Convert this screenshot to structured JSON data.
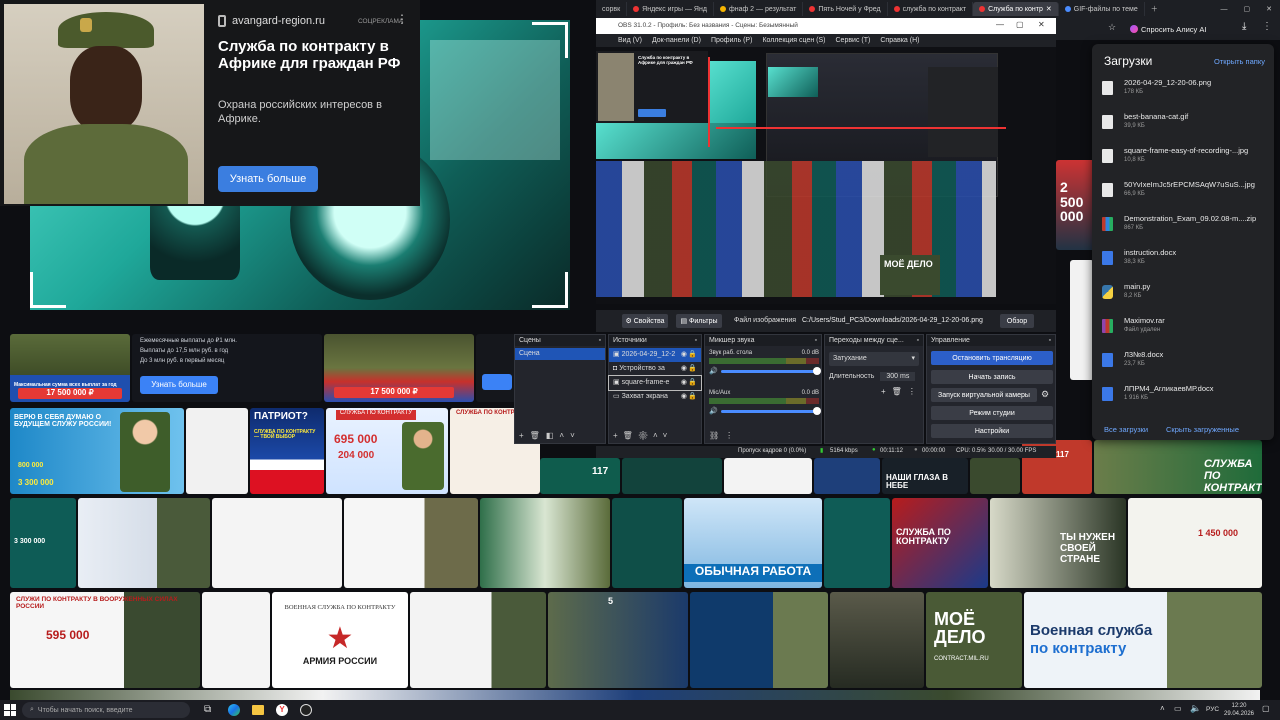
{
  "ad": {
    "domain": "avangard-region.ru",
    "tag": "СОЦРЕКЛАМА",
    "title": "Служба по контракту в Африке для граждан РФ",
    "subtitle": "Охрана российских интересов в Африке.",
    "cta": "Узнать больше"
  },
  "browser": {
    "tabs": [
      {
        "label": "сорвк",
        "color": "#888"
      },
      {
        "label": "Яндекс игры — Янд",
        "color": "#e33"
      },
      {
        "label": "фнаф 2 — результат",
        "color": "#f5b400"
      },
      {
        "label": "Пять Ночей у Фред",
        "color": "#e33"
      },
      {
        "label": "служба по контракт",
        "color": "#e33"
      },
      {
        "label": "Служба по контр",
        "color": "#e33"
      },
      {
        "label": "GIF-файлы по теме",
        "color": "#4a8cff"
      }
    ],
    "alice": "Спросить Алису AI"
  },
  "obs": {
    "title": "OBS 31.0.2 - Профиль: Без названия - Сцены: Безымянный",
    "menu": [
      "Вид (V)",
      "Док-панели (D)",
      "Профиль (P)",
      "Коллекция сцен (S)",
      "Сервис (T)",
      "Справка (H)"
    ],
    "props_label": "Свойства",
    "filters_label": "Фильтры",
    "file_label": "Файл изображения",
    "file_path": "C:/Users/Stud_PC3/Downloads/2026-04-29_12-20-06.png",
    "browse": "Обзор",
    "scenes_title": "Сцены",
    "scenes": [
      "Сцена"
    ],
    "sources_title": "Источники",
    "sources": [
      "2026-04-29_12-2",
      "Устройство за",
      "square-frame-e",
      "Захват экрана"
    ],
    "mixer_title": "Микшер звука",
    "mixer": [
      {
        "name": "Звук раб. стола",
        "db": "0.0 dB"
      },
      {
        "name": "Mic/Aux",
        "db": "0.0 dB"
      }
    ],
    "transitions_title": "Переходы между сце...",
    "transition": "Затухание",
    "duration_label": "Длительность",
    "duration": "300 ms",
    "controls_title": "Управление",
    "controls": [
      "Остановить трансляцию",
      "Начать запись",
      "Запуск виртуальной камеры",
      "Режим студии",
      "Настройки"
    ],
    "status": {
      "dropped": "Пропуск кадров 0 (0.0%)",
      "kbps": "5164 kbps",
      "live": "00:11:12",
      "rec": "00:00:00",
      "cpu": "CPU: 0.5%",
      "fps": "30.00 / 30.00 FPS"
    }
  },
  "downloads": {
    "title": "Загрузки",
    "open_folder": "Открыть папку",
    "items": [
      {
        "name": "2026-04-29_12-20-06.png",
        "size": "178 КБ",
        "color": "#9aa7ff"
      },
      {
        "name": "best-banana-cat.gif",
        "size": "39,9 КБ",
        "color": "#9aa7ff"
      },
      {
        "name": "square-frame-easy-of-recording-...jpg",
        "size": "10,8 КБ",
        "color": "#9aa7ff"
      },
      {
        "name": "50YvIxeImJc5rEPCMSAqW7uSuS...jpg",
        "size": "66,9 КБ",
        "color": "#9aa7ff"
      },
      {
        "name": "Demonstration_Exam_09.02.08-m....zip",
        "size": "867 КБ",
        "color": "#e6a23c"
      },
      {
        "name": "instruction.docx",
        "size": "38,3 КБ",
        "color": "#3b78e7"
      },
      {
        "name": "main.py",
        "size": "8,2 КБ",
        "color": "#f5d142"
      },
      {
        "name": "Maximov.rar",
        "size": "Файл удален",
        "color": "#b04fa0"
      },
      {
        "name": "Л3№8.docx",
        "size": "23,7 КБ",
        "color": "#3b78e7"
      },
      {
        "name": "ЛПРМ4_АгликаевМР.docx",
        "size": "1 916 КБ",
        "color": "#3b78e7"
      }
    ],
    "all": "Все загрузки",
    "hide": "Скрыть загруженные"
  },
  "grid": {
    "tile1_cta": "Узнать больше",
    "tile1_text": [
      "Ежемесячные выплаты до ₽1 млн.",
      "Выплаты до 17,5 млн руб. в год",
      "До 3 млн руб. в первый месяц"
    ],
    "tile1_sum": "Максимальная сумма всех выплат за год",
    "tile1_amount": "17 500 000 ₽",
    "tile2_amount": "17 500 000 ₽",
    "t_verim": "ВЕРЮ В СЕБЯ ДУМАЮ О БУДУЩЕМ СЛУЖУ РОССИИ!",
    "t_verim_nums": [
      "800 000",
      "3 300 000"
    ],
    "t_patriot": "ПАТРИОТ?",
    "t_patriot_sub": "СЛУЖБА ПО КОНТРАКТУ — ТВОЙ ВЫБОР",
    "t_695": "695 000",
    "t_204": "204 000",
    "t_sluzhba": "СЛУЖБА ПО КОНТРАКТУ",
    "t_117": "117",
    "t_nashi": "НАШИ ГЛАЗА В НЕБЕ",
    "t_obych": "ОБЫЧНАЯ РАБОТА",
    "t_nuzhen": "ТЫ НУЖЕН СВОЕЙ СТРАНЕ",
    "t_vvs": "СЛУЖИ ПО КОНТРАКТУ В ВООРУЖЕННЫХ СИЛАХ РОССИИ",
    "t_595": "595 000",
    "t_army": "АРМИЯ РОССИИ",
    "t_voen": "ВОЕННАЯ СЛУЖБА ПО КОНТРАКТУ",
    "t_moe": "МОЁ ДЕЛО",
    "t_moe_site": "CONTRACT.MIL.RU",
    "t_voen2": "Военная служба",
    "t_voen2b": "по контракту",
    "t_3300": "3 300 000",
    "t_2500": "2 500 000",
    "t_650": "1 450 000",
    "t_5": "5"
  },
  "taskbar": {
    "search_placeholder": "Чтобы начать поиск, введите",
    "lang": "РУС",
    "time": "12:20",
    "date": "29.04.2026"
  }
}
